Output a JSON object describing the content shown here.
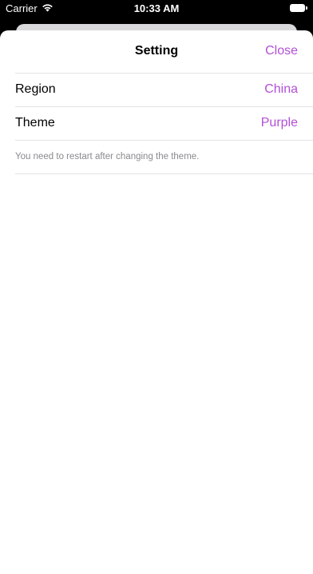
{
  "status_bar": {
    "carrier": "Carrier",
    "time": "10:33 AM",
    "wifi_icon": "wifi-icon",
    "battery_icon": "battery-icon"
  },
  "sheet": {
    "title": "Setting",
    "close_label": "Close",
    "accent_color": "#b34fd6",
    "rows": [
      {
        "label": "Region",
        "value": "China"
      },
      {
        "label": "Theme",
        "value": "Purple"
      }
    ],
    "footnote": "You need to restart after changing the theme."
  }
}
